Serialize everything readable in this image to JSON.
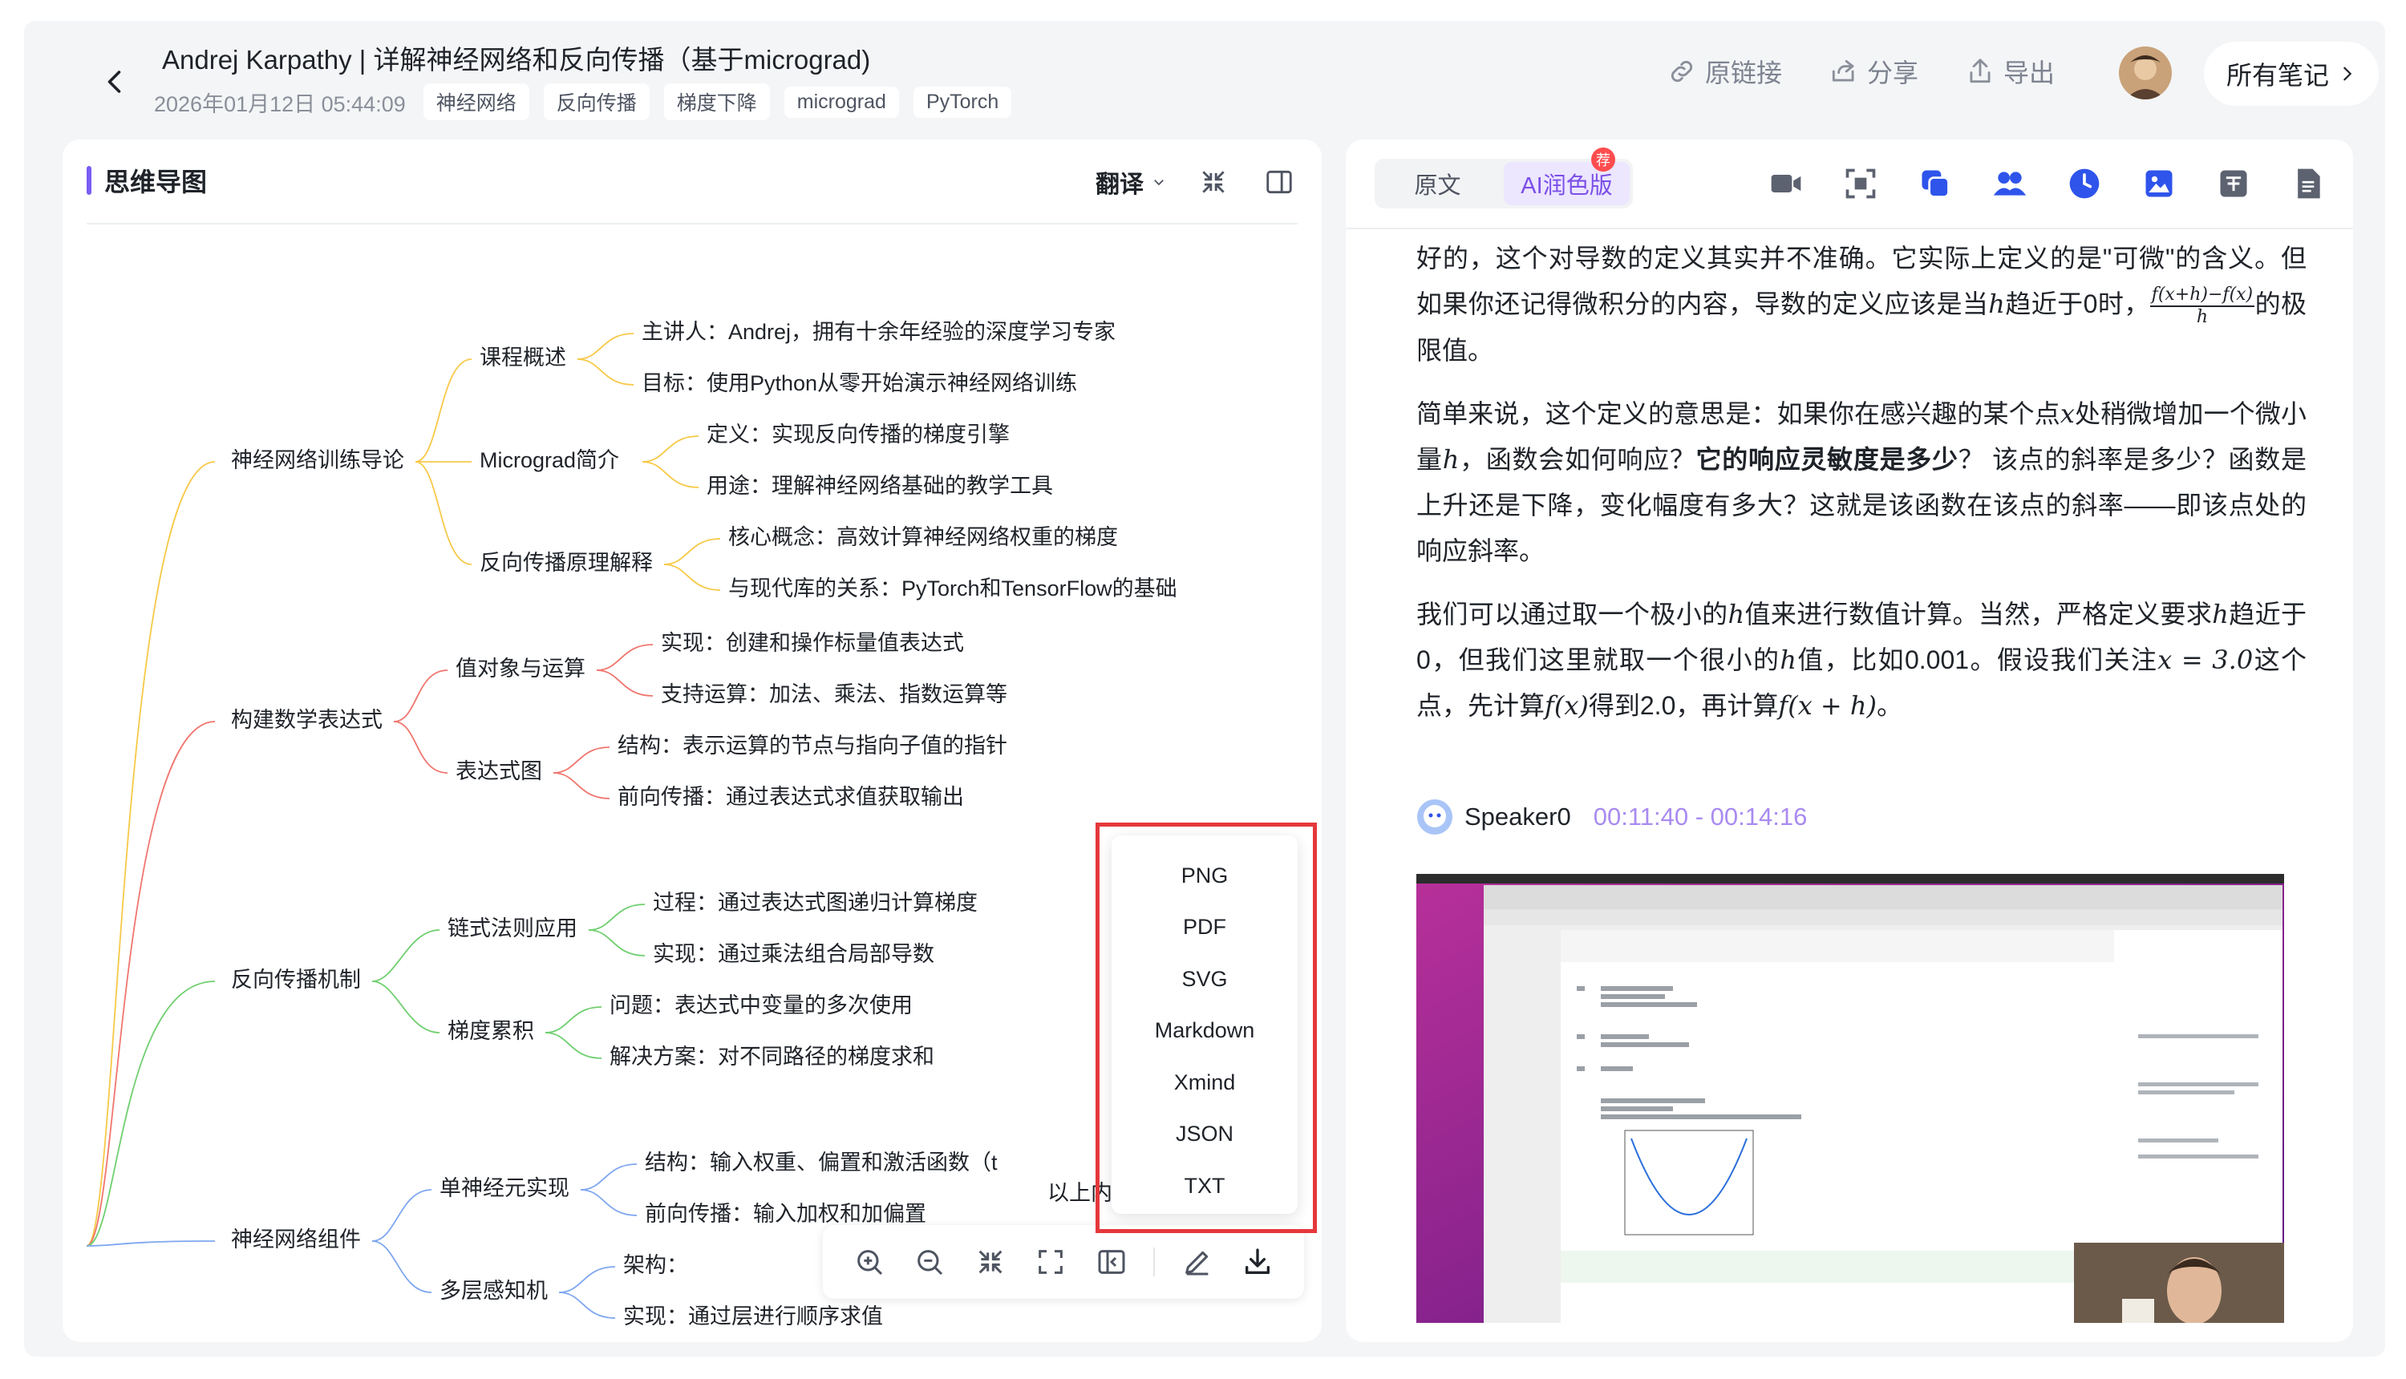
{
  "header": {
    "title": "Andrej Karpathy | 详解神经网络和反向传播（基于micrograd)",
    "date": "2026年01月12日 05:44:09",
    "tags": [
      "神经网络",
      "反向传播",
      "梯度下降",
      "micrograd",
      "PyTorch"
    ],
    "actions": [
      {
        "label": "原链接",
        "icon": "link-icon"
      },
      {
        "label": "分享",
        "icon": "share-icon"
      },
      {
        "label": "导出",
        "icon": "export-icon"
      }
    ],
    "all_notes_label": "所有笔记"
  },
  "left_panel": {
    "title": "思维导图",
    "translate_label": "翻译",
    "mindmap": {
      "branches": [
        {
          "label": "神经网络训练导论",
          "color": "#f7c948",
          "children": [
            {
              "label": "课程概述",
              "leaves": [
                "主讲人：Andrej，拥有十余年经验的深度学习专家",
                "目标：使用Python从零开始演示神经网络训练"
              ]
            },
            {
              "label": "Micrograd简介",
              "leaves": [
                "定义：实现反向传播的梯度引擎",
                "用途：理解神经网络基础的教学工具"
              ]
            },
            {
              "label": "反向传播原理解释",
              "leaves": [
                "核心概念：高效计算神经网络权重的梯度",
                "与现代库的关系：PyTorch和TensorFlow的基础"
              ]
            }
          ]
        },
        {
          "label": "构建数学表达式",
          "color": "#f0766f",
          "children": [
            {
              "label": "值对象与运算",
              "leaves": [
                "实现：创建和操作标量值表达式",
                "支持运算：加法、乘法、指数运算等"
              ]
            },
            {
              "label": "表达式图",
              "leaves": [
                "结构：表示运算的节点与指向子值的指针",
                "前向传播：通过表达式求值获取输出"
              ]
            }
          ]
        },
        {
          "label": "反向传播机制",
          "color": "#6fcf6f",
          "children": [
            {
              "label": "链式法则应用",
              "leaves": [
                "过程：通过表达式图递归计算梯度",
                "实现：通过乘法组合局部导数"
              ]
            },
            {
              "label": "梯度累积",
              "leaves": [
                "问题：表达式中变量的多次使用",
                "解决方案：对不同路径的梯度求和"
              ]
            }
          ]
        },
        {
          "label": "神经网络组件",
          "color": "#7fa7f0",
          "children": [
            {
              "label": "单神经元实现",
              "leaves": [
                "结构：输入权重、偏置和激活函数（t",
                "前向传播：输入加权和加偏置"
              ]
            },
            {
              "label": "多层感知机",
              "leaves": [
                "架构：",
                "实现：通过层进行顺序求值"
              ]
            }
          ]
        }
      ]
    },
    "watermark_text": "以上内",
    "export_menu": [
      "PNG",
      "PDF",
      "SVG",
      "Markdown",
      "Xmind",
      "JSON",
      "TXT"
    ]
  },
  "right_panel": {
    "tabs": [
      "原文",
      "AI润色版"
    ],
    "active_tab": "AI润色版",
    "badge": "荐",
    "article": {
      "p1_a": "好的，这个对导数的定义其实并不准确。它实际上定义的是\"可微\"的含义。但如果你还记得微积分的内容，导数的定义应该是当",
      "p1_h": "h",
      "p1_b": "趋近于0时，",
      "frac_num": "f(x+h)−f(x)",
      "frac_den": "h",
      "p1_c": "的极限值。",
      "p2_a": "简单来说，这个定义的意思是：如果你在感兴趣的某个点",
      "p2_x": "x",
      "p2_b": "处稍微增加一个微小量",
      "p2_h": "h",
      "p2_c": "，函数会如何响应？",
      "p2_bold": "它的响应灵敏度是多少",
      "p2_d": "？ 该点的斜率是多少？函数是上升还是下降，变化幅度有多大？这就是该函数在该点的斜率——即该点处的响应斜率。",
      "p3_a": "我们可以通过取一个极小的",
      "p3_h1": "h",
      "p3_b": "值来进行数值计算。当然，严格定义要求",
      "p3_h2": "h",
      "p3_c": "趋近于0，但我们这里就取一个很小的",
      "p3_h3": "h",
      "p3_d": "值，比如0.001。假设我们关注",
      "p3_eq": "x = 3.0",
      "p3_e": "这个点，先计算",
      "p3_fx": "f(x)",
      "p3_f": "得到2.0，再计算",
      "p3_fxh": "f(x + h)",
      "p3_g": "。"
    },
    "speaker": {
      "name": "Speaker0",
      "time": "00:11:40 - 00:14:16"
    }
  },
  "colors": {
    "accent": "#7b4fe8",
    "highlight_border": "#e5383b"
  }
}
